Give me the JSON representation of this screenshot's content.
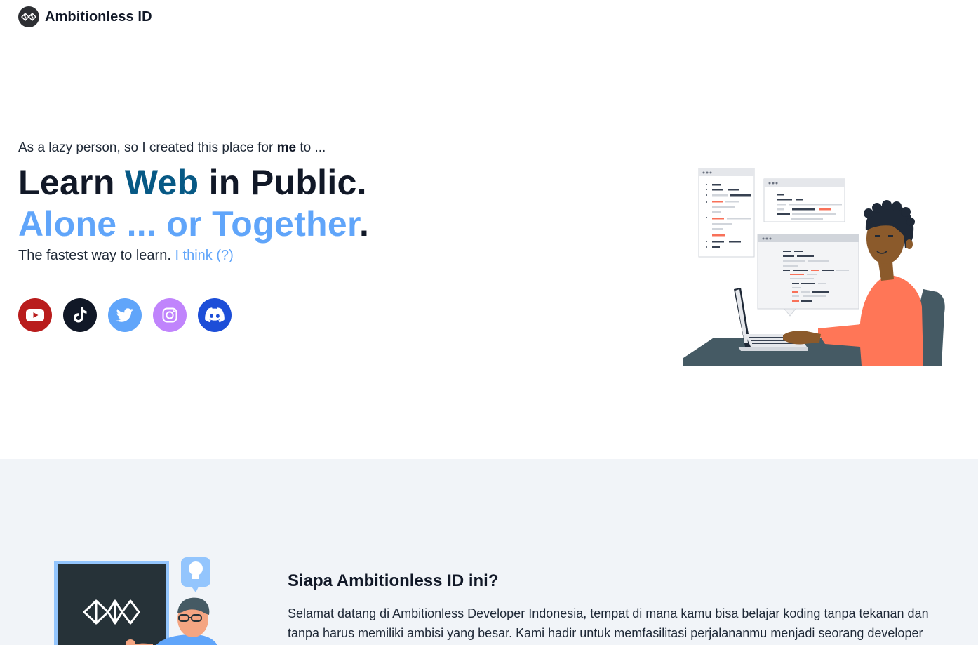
{
  "brand": {
    "name": "Ambitionless ID",
    "logo_icon": "brain-logo-icon"
  },
  "hero": {
    "tagline_pre": "As a lazy person, so I created this place for ",
    "tagline_bold": "me",
    "tagline_post": " to ...",
    "line1_a": "Learn ",
    "line1_b": "Web",
    "line1_c": " in Public.",
    "line2_a": "Alone ... or Together",
    "line2_b": ".",
    "sub_text": "The fastest way to learn. ",
    "sub_link": "I think (?)",
    "illustration": "developer-coding-at-laptop-illustration",
    "colors": {
      "dark": "#111827",
      "web": "#075985",
      "accent": "#60a5fa"
    }
  },
  "socials": [
    {
      "name": "YouTube",
      "icon": "youtube-icon",
      "color": "#b91c1c"
    },
    {
      "name": "TikTok",
      "icon": "tiktok-icon",
      "color": "#111827"
    },
    {
      "name": "Twitter",
      "icon": "twitter-icon",
      "color": "#60a5fa"
    },
    {
      "name": "Instagram",
      "icon": "instagram-icon",
      "color": "#c084fc"
    },
    {
      "name": "Discord",
      "icon": "discord-icon",
      "color": "#1d4ed8"
    }
  ],
  "about": {
    "title": "Siapa Ambitionless ID ini?",
    "text": "Selamat datang di Ambitionless Developer Indonesia, tempat di mana kamu bisa belajar koding tanpa tekanan dan tanpa harus memiliki ambisi yang besar. Kami hadir untuk memfasilitasi perjalananmu menjadi seorang developer",
    "illustration": "teacher-at-blackboard-illustration",
    "background": "#f1f4f8"
  }
}
